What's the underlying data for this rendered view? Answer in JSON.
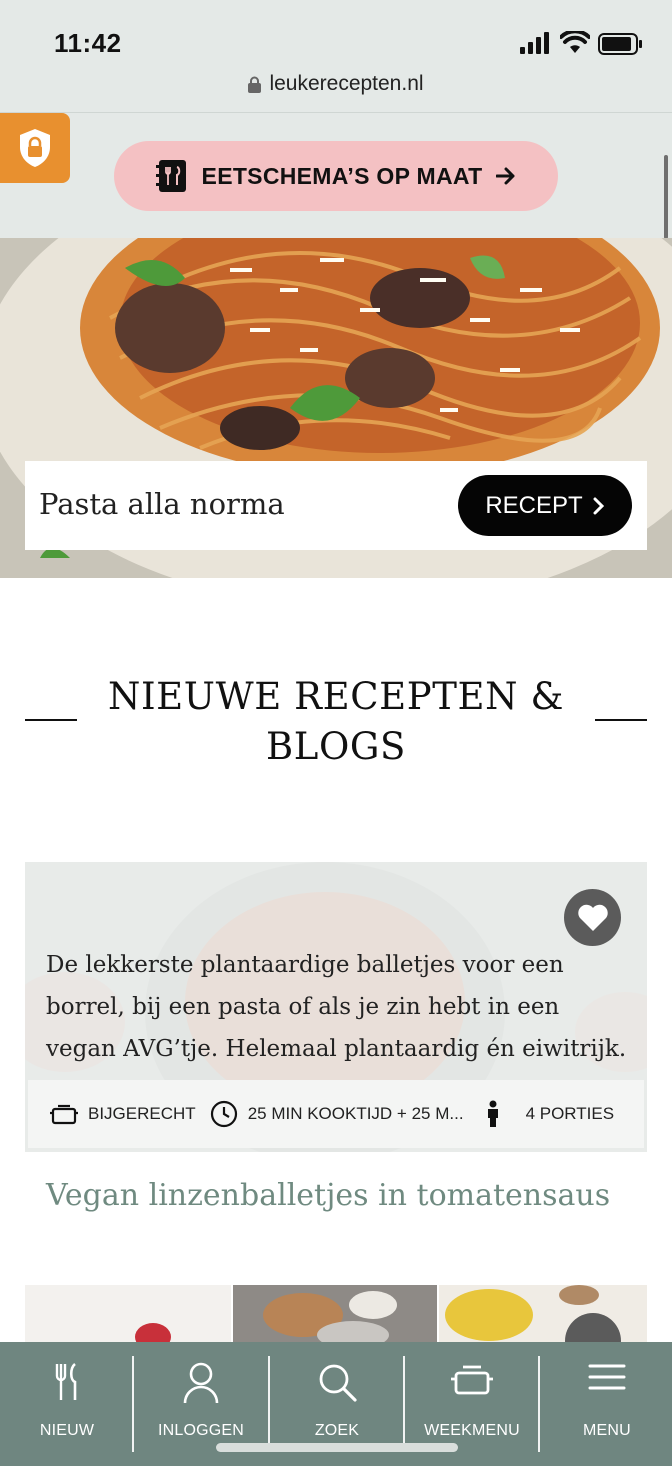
{
  "status_bar": {
    "time": "11:42",
    "url": "leukerecepten.nl"
  },
  "promo": {
    "label": "EETSCHEMA’S OP MAAT"
  },
  "hero": {
    "title": "Pasta alla norma",
    "button_label": "RECEPT"
  },
  "section": {
    "title": "NIEUWE RECEPTEN & BLOGS"
  },
  "recipe_card": {
    "description": "De lekkerste plantaardige balletjes voor een borrel, bij een pasta of als je zin hebt in een vegan AVG’tje. Helemaal plantaardig én eiwitrijk.",
    "category": "BIJGERECHT",
    "time": "25 MIN KOOKTIJD + 25 M...",
    "portions": "4 PORTIES",
    "title": "Vegan linzenballetjes in tomatensaus"
  },
  "bottom_nav": [
    {
      "label": "NIEUW",
      "icon": "fork-knife-icon"
    },
    {
      "label": "INLOGGEN",
      "icon": "user-icon"
    },
    {
      "label": "ZOEK",
      "icon": "search-icon"
    },
    {
      "label": "WEEKMENU",
      "icon": "pot-icon"
    },
    {
      "label": "MENU",
      "icon": "hamburger-icon"
    }
  ],
  "colors": {
    "accent_orange": "#e8902f",
    "promo_pink": "#f4c1c3",
    "nav_green": "#6f8680",
    "title_green": "#6f8a80"
  }
}
